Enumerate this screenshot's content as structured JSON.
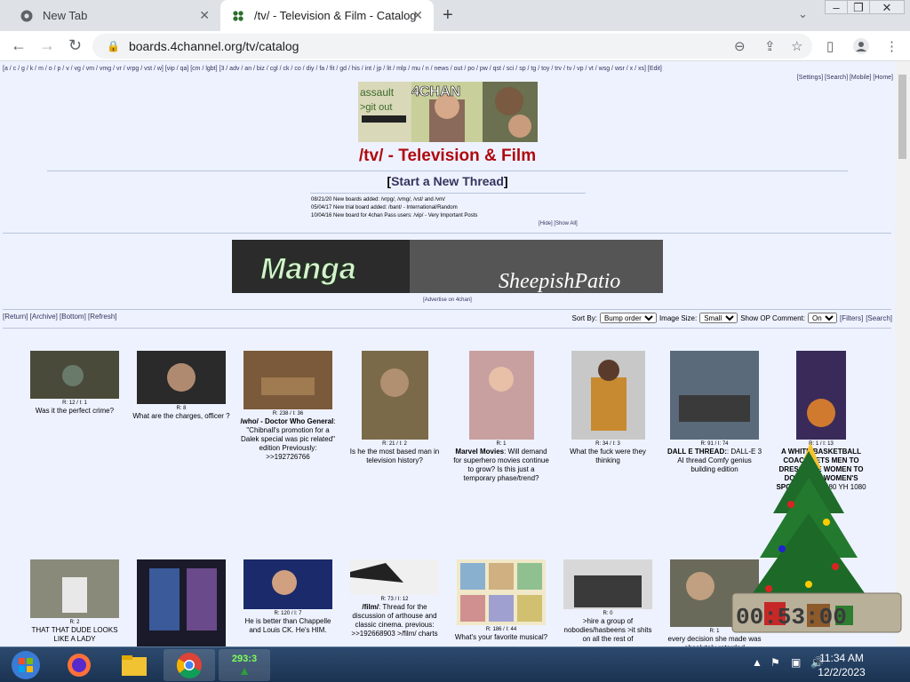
{
  "browser": {
    "tabs": [
      {
        "title": "New Tab"
      },
      {
        "title": "/tv/ - Television & Film - Catalog"
      }
    ],
    "url": "boards.4channel.org/tv/catalog"
  },
  "board_nav": {
    "links": "[a / c / g / k / m / o / p / v / vg / vm / vmg / vr / vrpg / vst / w] [vip / qa] [cm / lgbt] [3 / adv / an / biz / cgl / ck / co / diy / fa / fit / gd / his / int / jp / lit / mlp / mu / n / news / out / po / pw / qst / sci / sp / tg / toy / trv / tv / vp / vt / wsg / wsr / x / xs] [Edit]",
    "right_line1": "[Edit]",
    "right_line2": "[Settings] [Search] [Mobile] [Home]"
  },
  "board": {
    "title": "/tv/ - Television & Film",
    "new_thread": "Start a New Thread",
    "banner_text": "4CHAN",
    "news": [
      "08/21/20 New boards added: /vrpg/, /vmg/, /vst/ and /vm/",
      "05/04/17 New trial board added: /bant/ - International/Random",
      "10/04/16 New board for 4chan Pass users: /vip/ - Very Important Posts"
    ],
    "news_controls": "[Hide] [Show All]",
    "ad_text_left": "Manga",
    "ad_text_right": "SheepishPatio",
    "ad_note": "[Advertise on 4chan]"
  },
  "catalog_controls": {
    "nav": "[Return] [Archive] [Bottom] [Refresh]",
    "sort_label": "Sort By:",
    "sort_value": "Bump order",
    "size_label": "Image Size:",
    "size_value": "Small",
    "op_label": "Show OP Comment:",
    "op_value": "On",
    "filters": "[Filters]",
    "search": "[Search]"
  },
  "threads": [
    {
      "stats": "R: 12 / I: 1",
      "subject": "",
      "teaser": "Was it the perfect crime?"
    },
    {
      "stats": "R: 8",
      "subject": "",
      "teaser": "What are the charges, officer ?"
    },
    {
      "stats": "R: 238 / I: 36",
      "subject": "/who/ - Doctor Who General",
      "teaser": ": \"Chibnall's promotion for a Dalek special was pic related\" edition Previously: >>192726766"
    },
    {
      "stats": "R: 21 / I: 2",
      "subject": "",
      "teaser": "Is he the most based man in television history?"
    },
    {
      "stats": "R: 1",
      "subject": "Marvel Movies",
      "teaser": ": Will demand for superhero movies continue to grow? Is this just a temporary phase/trend?"
    },
    {
      "stats": "R: 34 / I: 3",
      "subject": "",
      "teaser": "What the fuck were they thinking"
    },
    {
      "stats": "R: 91 / I: 74",
      "subject": "DALL E THREAD:",
      "teaser": ": DALL-E 3 AI thread Comfy genius building edition"
    },
    {
      "stats": "R: 1 / I: 13",
      "subject": "A WHITE BASKETBALL COACH LETS MEN TO DRESS LIKE WOMEN TO DOMINATE WOMEN'S SPORTS!",
      "teaser": "TS 1080 YH 1080"
    },
    {
      "stats": "R: 2",
      "subject": "",
      "teaser": "THAT THAT DUDE LOOKS LIKE A LADY"
    },
    {
      "stats": "",
      "subject": "",
      "teaser": ""
    },
    {
      "stats": "R: 120 / I: 7",
      "subject": "",
      "teaser": "He is better than Chappelle and Louis CK. He's HIM."
    },
    {
      "stats": "R: 73 / I: 12",
      "subject": "/film/",
      "teaser": ": Thread for the discussion of arthouse and classic cinema. previous: >>192668903 >/film/ charts"
    },
    {
      "stats": "R: 186 / I: 44",
      "subject": "",
      "teaser": "What's your favorite musical?"
    },
    {
      "stats": "R: 0",
      "subject": "",
      "teaser": ">hire a group of nobodies/hasbeens >it shits on all the rest of"
    },
    {
      "stats": "R: 1",
      "subject": "",
      "teaser": "every decision she made was absolutely retarded"
    }
  ],
  "overlay": {
    "counter_digits": "00:53:00"
  },
  "taskbar": {
    "counter": "293:3",
    "time": "11:34 AM",
    "date": "12/2/2023"
  }
}
